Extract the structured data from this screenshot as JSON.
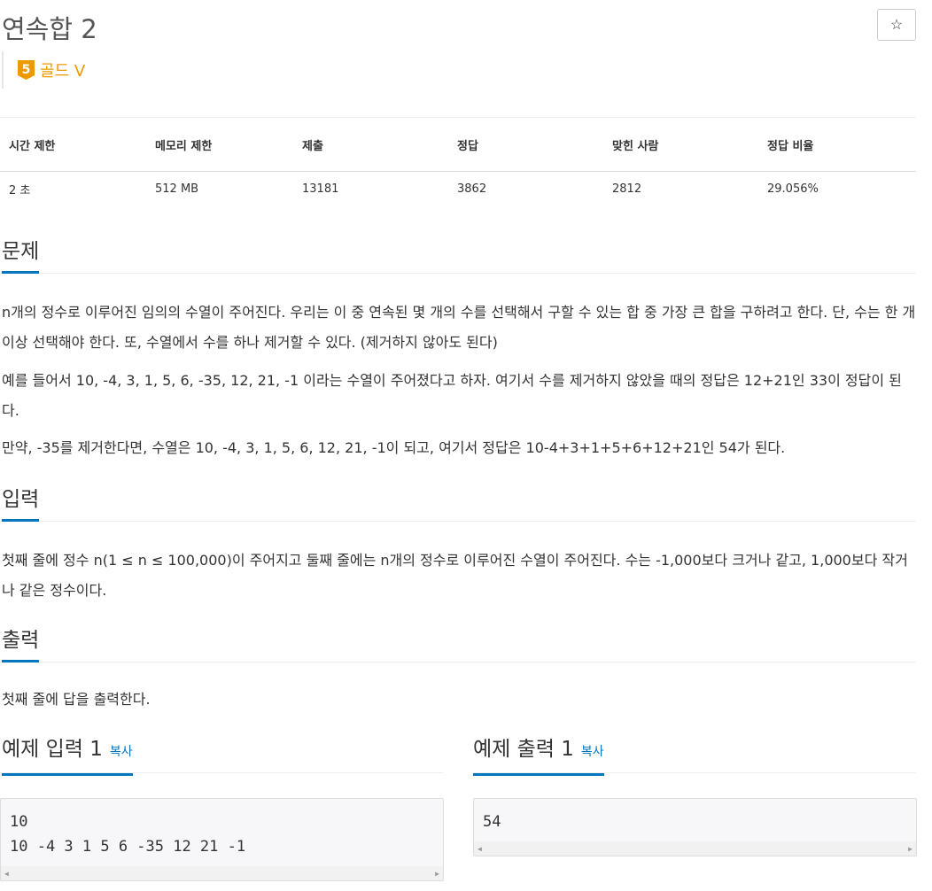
{
  "problem": {
    "title": "연속합 2",
    "tier": {
      "number": "5",
      "label": "골드 V",
      "color": "#ec9a00"
    }
  },
  "star_icon": "☆",
  "info": {
    "headers": [
      "시간 제한",
      "메모리 제한",
      "제출",
      "정답",
      "맞힌 사람",
      "정답 비율"
    ],
    "values": [
      "2 초",
      "512 MB",
      "13181",
      "3862",
      "2812",
      "29.056%"
    ]
  },
  "sections": {
    "problem": {
      "title": "문제",
      "paragraphs": [
        "n개의 정수로 이루어진 임의의 수열이 주어진다. 우리는 이 중 연속된 몇 개의 수를 선택해서 구할 수 있는 합 중 가장 큰 합을 구하려고 한다. 단, 수는 한 개 이상 선택해야 한다. 또, 수열에서 수를 하나 제거할 수 있다. (제거하지 않아도 된다)",
        "예를 들어서 10, -4, 3, 1, 5, 6, -35, 12, 21, -1 이라는 수열이 주어졌다고 하자. 여기서 수를 제거하지 않았을 때의 정답은 12+21인 33이 정답이 된다.",
        "만약, -35를 제거한다면, 수열은 10, -4, 3, 1, 5, 6, 12, 21, -1이 되고, 여기서 정답은 10-4+3+1+5+6+12+21인 54가 된다."
      ]
    },
    "input": {
      "title": "입력",
      "text": "첫째 줄에 정수 n(1 ≤ n ≤ 100,000)이 주어지고 둘째 줄에는 n개의 정수로 이루어진 수열이 주어진다. 수는 -1,000보다 크거나 같고, 1,000보다 작거나 같은 정수이다."
    },
    "output": {
      "title": "출력",
      "text": "첫째 줄에 답을 출력한다."
    }
  },
  "samples": {
    "input": {
      "title": "예제 입력 1",
      "copy_label": "복사",
      "content": "10\n10 -4 3 1 5 6 -35 12 21 -1"
    },
    "output": {
      "title": "예제 출력 1",
      "copy_label": "복사",
      "content": "54"
    }
  },
  "accent_color": "#0076c0"
}
